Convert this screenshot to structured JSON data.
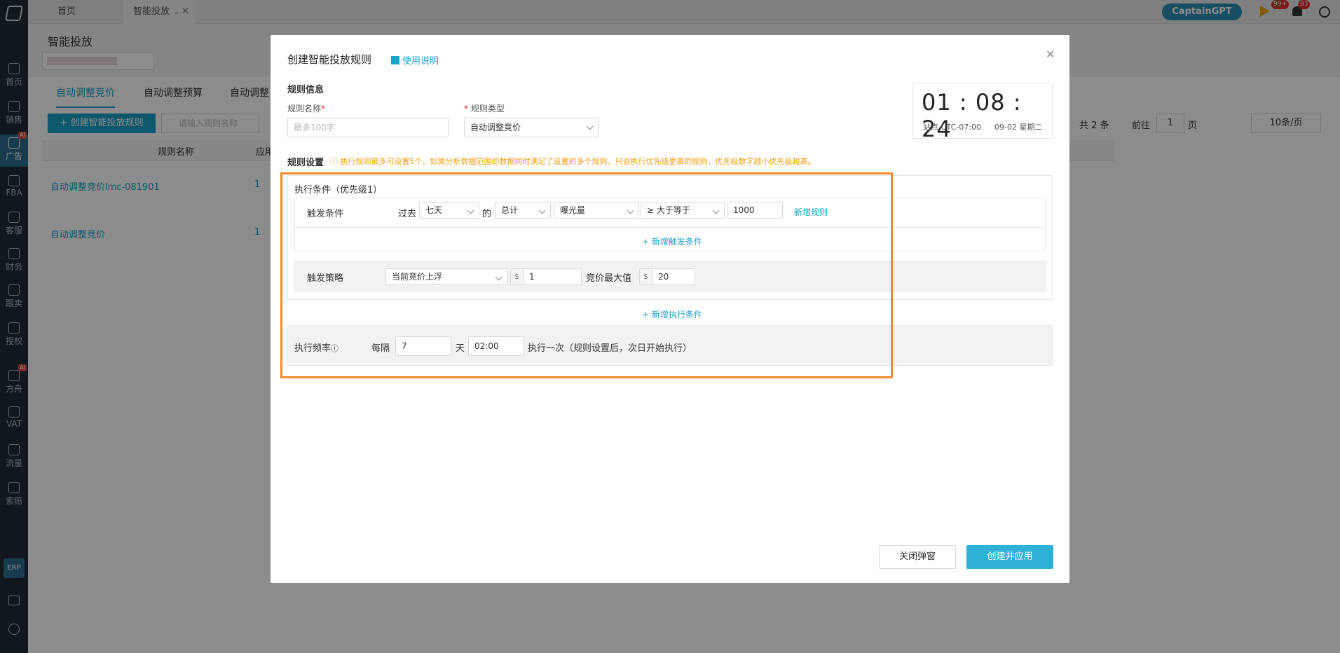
{
  "sidebar": {
    "items": [
      {
        "label": "首页",
        "icon": "home-icon"
      },
      {
        "label": "销售",
        "icon": "chart-icon"
      },
      {
        "label": "广告",
        "icon": "ad-icon",
        "badge": "AI"
      },
      {
        "label": "FBA",
        "icon": "box-icon"
      },
      {
        "label": "客服",
        "icon": "service-icon"
      },
      {
        "label": "财务",
        "icon": "dollar-icon"
      },
      {
        "label": "跟卖",
        "icon": "pie-icon"
      },
      {
        "label": "授权",
        "icon": "shield-icon"
      },
      {
        "label": "方舟",
        "icon": "ark-icon",
        "badge": "AI"
      },
      {
        "label": "VAT",
        "icon": "building-icon"
      },
      {
        "label": "流量",
        "icon": "traffic-icon"
      },
      {
        "label": "索赔",
        "icon": "claim-icon"
      }
    ],
    "erp_label": "ERP"
  },
  "topbar": {
    "tabs": [
      "首页",
      "智能投放"
    ],
    "captain_label": "CaptainGPT",
    "badge_flag": "99+",
    "badge_bell": "93"
  },
  "page": {
    "title": "智能投放",
    "tabs": [
      "自动调整竞价",
      "自动调整预算",
      "自动调整"
    ],
    "create_button": "+ 创建智能投放规则",
    "search_placeholder": "请输入规则名称",
    "table_headers": [
      "规则名称",
      "应用"
    ],
    "rows": [
      {
        "name": "自动调整竞价lmc-081901",
        "count": "1"
      },
      {
        "name": "自动调整竞价",
        "count": "1"
      }
    ],
    "pager": {
      "total": "共 2 条",
      "goto": "前往",
      "page": "1",
      "page_unit": "页",
      "page_size": "10条/页"
    }
  },
  "modal": {
    "title": "创建智能投放规则",
    "help_link": "使用说明",
    "section_info": "规则信息",
    "name_label": "规则名称",
    "name_placeholder": "最多100字",
    "type_label": "规则类型",
    "type_value": "自动调整竞价",
    "clock": {
      "time": "01 : 08 : 24",
      "zone": "站点 UTC-07:00",
      "date": "09-02 星期二"
    },
    "section_rules": "规则设置",
    "rules_hint": "执行规则最多可设置5个。如果分析数据范围的数据同时满足了设置的多个规则，只会执行优先级更高的规则，优先级数字越小优先级越高。",
    "condition_title": "执行条件（优先级1）",
    "trigger_label": "触发条件",
    "past_label": "过去",
    "period_value": "七天",
    "of_label": "的",
    "agg_value": "总计",
    "metric_value": "曝光量",
    "operator_value": "≥ 大于等于",
    "threshold_value": "1000",
    "add_rule_link": "新增规则",
    "add_trigger_link": "+ 新增触发条件",
    "strategy_label": "触发策略",
    "strategy_value": "当前竞价上浮",
    "currency": "$",
    "strategy_amount": "1",
    "max_bid_label": "竞价最大值",
    "max_bid_value": "20",
    "add_condition_link": "+ 新增执行条件",
    "freq_label": "执行频率",
    "every_label": "每隔",
    "every_value": "7",
    "day_label": "天",
    "time_value": "02:00",
    "freq_suffix": "执行一次（规则设置后，次日开始执行）",
    "close_button": "关闭弹窗",
    "submit_button": "创建并应用"
  },
  "colors": {
    "accent": "#1aa1c7",
    "highlight": "#f28a30",
    "hint": "#f39c12"
  }
}
